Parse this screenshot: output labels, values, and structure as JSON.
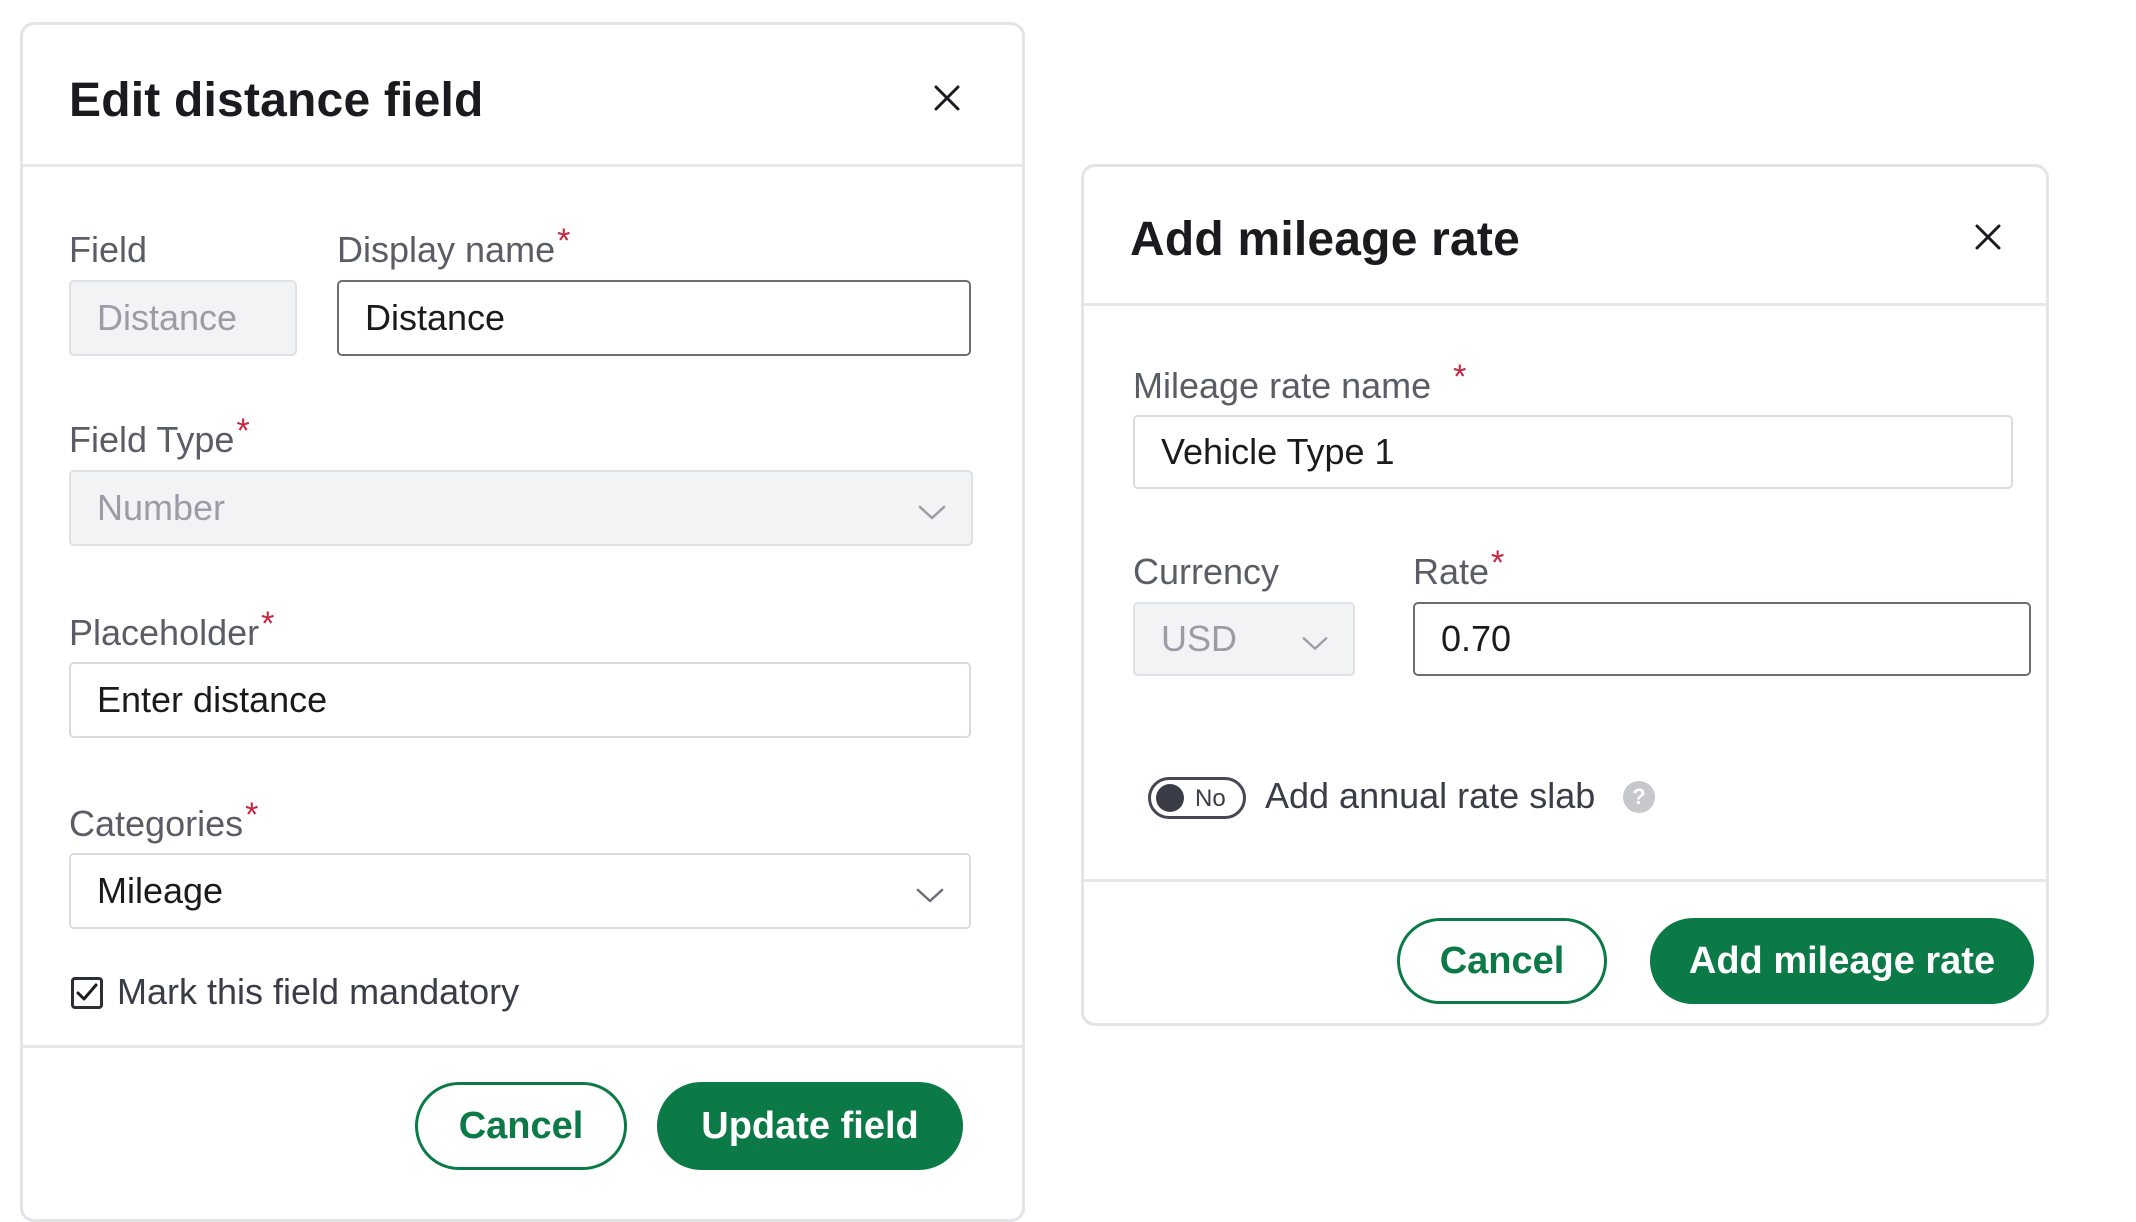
{
  "edit_modal": {
    "title": "Edit distance field",
    "field_label": "Field",
    "field_value": "Distance",
    "display_name_label": "Display name",
    "display_name_value": "Distance",
    "field_type_label": "Field Type",
    "field_type_value": "Number",
    "placeholder_label": "Placeholder",
    "placeholder_value": "Enter distance",
    "categories_label": "Categories",
    "categories_value": "Mileage",
    "mandatory_label": "Mark this field mandatory",
    "mandatory_checked": true,
    "cancel_label": "Cancel",
    "submit_label": "Update field"
  },
  "mileage_modal": {
    "title": "Add mileage rate",
    "rate_name_label": "Mileage rate name",
    "rate_name_value": "Vehicle Type 1",
    "currency_label": "Currency",
    "currency_value": "USD",
    "rate_label": "Rate",
    "rate_value": "0.70",
    "toggle_state": "No",
    "slab_label": "Add annual rate slab",
    "help_glyph": "?",
    "cancel_label": "Cancel",
    "submit_label": "Add mileage rate"
  },
  "required_marker": "*",
  "colors": {
    "primary": "#0b7a46",
    "required": "#c6263c",
    "border": "#d9dbe0"
  },
  "icons": [
    "close-icon",
    "chevron-down-icon",
    "checkmark-icon",
    "help-icon"
  ]
}
